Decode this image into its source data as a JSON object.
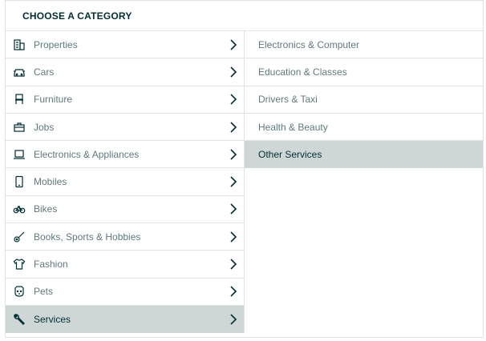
{
  "header": {
    "title": "CHOOSE A CATEGORY"
  },
  "categories": [
    {
      "label": "Properties",
      "icon": "building-icon"
    },
    {
      "label": "Cars",
      "icon": "car-icon"
    },
    {
      "label": "Furniture",
      "icon": "chair-icon"
    },
    {
      "label": "Jobs",
      "icon": "briefcase-icon"
    },
    {
      "label": "Electronics & Appliances",
      "icon": "laptop-icon"
    },
    {
      "label": "Mobiles",
      "icon": "phone-icon"
    },
    {
      "label": "Bikes",
      "icon": "bicycle-icon"
    },
    {
      "label": "Books, Sports & Hobbies",
      "icon": "guitar-icon"
    },
    {
      "label": "Fashion",
      "icon": "tshirt-icon"
    },
    {
      "label": "Pets",
      "icon": "paw-icon"
    },
    {
      "label": "Services",
      "icon": "wrench-icon",
      "selected": true
    }
  ],
  "subcategories": [
    {
      "label": "Electronics & Computer"
    },
    {
      "label": "Education & Classes"
    },
    {
      "label": "Drivers & Taxi"
    },
    {
      "label": "Health & Beauty"
    },
    {
      "label": "Other Services",
      "selected": true
    }
  ],
  "colors": {
    "selected_bg": "#ced6d6",
    "text": "#5f7a7d",
    "text_dark": "#002f34",
    "border": "#dfe3e3"
  }
}
